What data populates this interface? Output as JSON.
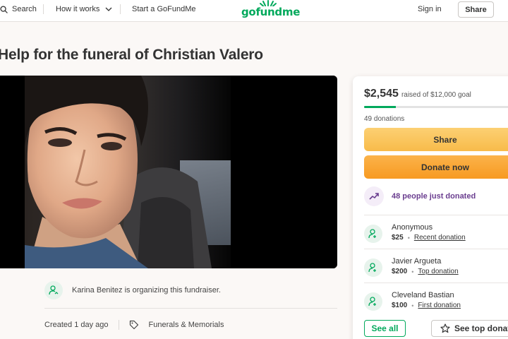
{
  "nav": {
    "search_label": "Search",
    "how_label": "How it works",
    "start_label": "Start a GoFundMe",
    "logo_text": "gofundme",
    "signin_label": "Sign in",
    "share_label": "Share"
  },
  "campaign": {
    "title": "Help for the funeral of Christian Valero",
    "organizer_text": "Karina Benitez is organizing this fundraiser.",
    "created": "Created 1 day ago",
    "category": "Funerals & Memorials"
  },
  "donation": {
    "raised": "$2,545",
    "goal_text": "raised of $12,000 goal",
    "progress_fraction": 0.212,
    "donations_count": "49 donations",
    "share_label": "Share",
    "donate_label": "Donate now",
    "just_donated": "48 people just donated",
    "donors": [
      {
        "name": "Anonymous",
        "amount": "$25",
        "kind": "Recent donation"
      },
      {
        "name": "Javier Argueta",
        "amount": "$200",
        "kind": "Top donation"
      },
      {
        "name": "Cleveland Bastian",
        "amount": "$100",
        "kind": "First donation"
      }
    ],
    "see_all_label": "See all",
    "see_top_label": "See top donations"
  },
  "colors": {
    "brand_green": "#02a95c",
    "share_yellow": "#f8bb4a",
    "donate_orange": "#f79a22",
    "trend_purple": "#6a3d8f"
  }
}
